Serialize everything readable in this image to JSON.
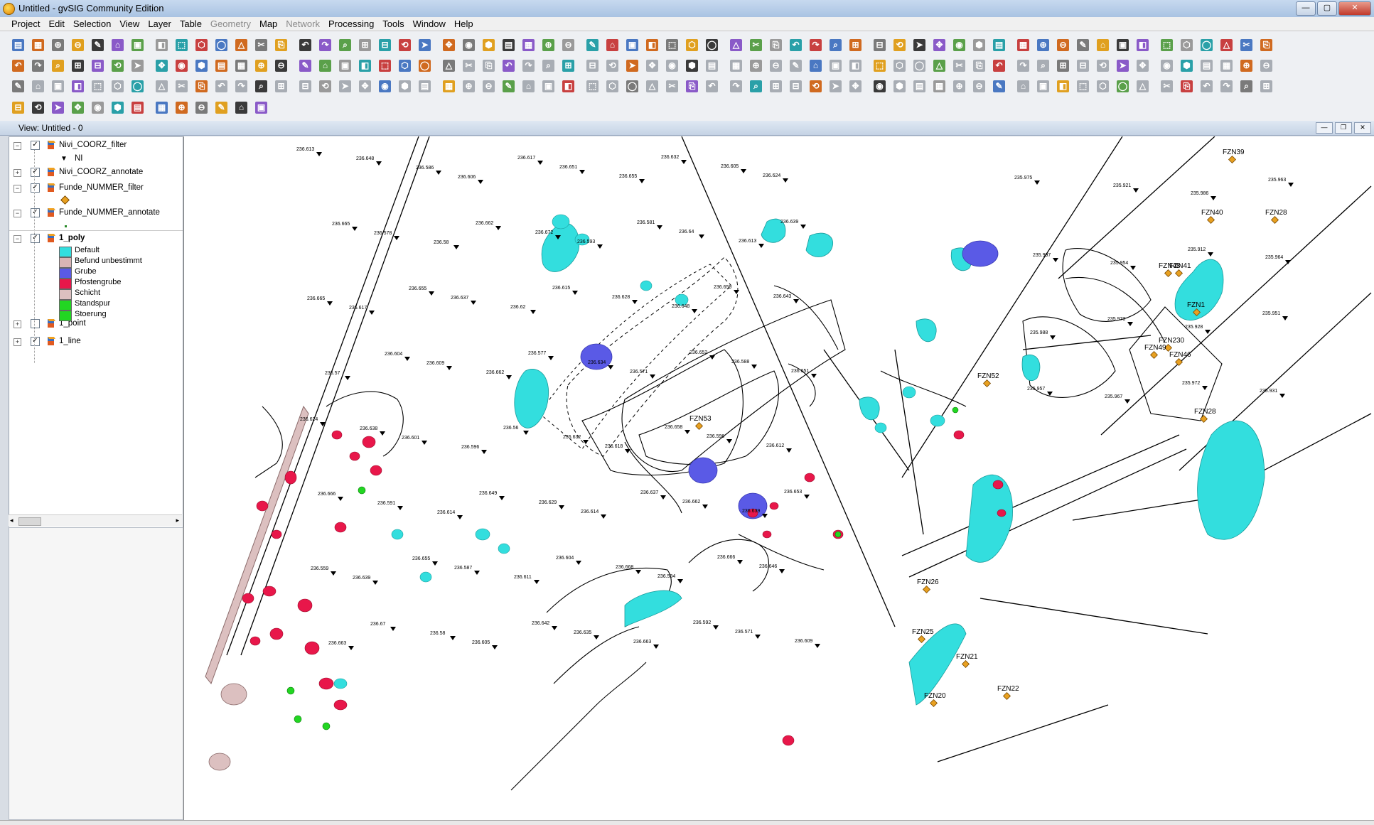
{
  "window": {
    "title": "Untitled - gvSIG Community Edition",
    "minimize": "—",
    "maximize": "▢",
    "close": "✕"
  },
  "menu": [
    {
      "key": "project",
      "label": "Project",
      "disabled": false
    },
    {
      "key": "edit",
      "label": "Edit",
      "disabled": false
    },
    {
      "key": "selection",
      "label": "Selection",
      "disabled": false
    },
    {
      "key": "view",
      "label": "View",
      "disabled": false
    },
    {
      "key": "layer",
      "label": "Layer",
      "disabled": false
    },
    {
      "key": "table",
      "label": "Table",
      "disabled": false
    },
    {
      "key": "geometry",
      "label": "Geometry",
      "disabled": true
    },
    {
      "key": "map",
      "label": "Map",
      "disabled": false
    },
    {
      "key": "network",
      "label": "Network",
      "disabled": true
    },
    {
      "key": "processing",
      "label": "Processing",
      "disabled": false
    },
    {
      "key": "tools",
      "label": "Tools",
      "disabled": false
    },
    {
      "key": "window",
      "label": "Window",
      "disabled": false
    },
    {
      "key": "help",
      "label": "Help",
      "disabled": false
    }
  ],
  "view": {
    "title": "View: Untitled - 0"
  },
  "toc": {
    "layers": [
      {
        "name": "Nivi_COORZ_filter",
        "checked": true,
        "expanded": true
      },
      {
        "name": "NI",
        "legend": true
      },
      {
        "name": "Nivi_COORZ_annotate",
        "checked": true,
        "expanded": false
      },
      {
        "name": "Funde_NUMMER_filter",
        "checked": true,
        "expanded": true
      },
      {
        "name": "Funde_NUMMER_annotate",
        "checked": true,
        "expanded": true
      },
      {
        "name": "1_poly",
        "checked": true,
        "expanded": true,
        "bold": true
      },
      {
        "name": "1_point",
        "checked": false,
        "expanded": false
      },
      {
        "name": "1_line",
        "checked": true,
        "expanded": false
      }
    ],
    "poly_legend": [
      {
        "label": "Default",
        "color": "#33dede"
      },
      {
        "label": "Befund unbestimmt",
        "color": "#d9b5b5"
      },
      {
        "label": "Grube",
        "color": "#5a5ae6"
      },
      {
        "label": "Pfostengrube",
        "color": "#e8174a"
      },
      {
        "label": "Schicht",
        "color": "#dcc0c0"
      },
      {
        "label": "Standspur",
        "color": "#22d622"
      },
      {
        "label": "Stoerung",
        "color": "#22d622"
      }
    ]
  },
  "map": {
    "colors": {
      "default": "#33dede",
      "grube": "#5a5ae6",
      "pfosten": "#e8174a",
      "standspur": "#22d622",
      "schicht": "#dcc0c0",
      "find": "#e8a020"
    },
    "finds": [
      {
        "label": "FZN39"
      },
      {
        "label": "FZN40"
      },
      {
        "label": "FZN28"
      },
      {
        "label": "FZN48"
      },
      {
        "label": "FZN41"
      },
      {
        "label": "FZN1"
      },
      {
        "label": "FZN230"
      },
      {
        "label": "FZN49"
      },
      {
        "label": "FZN46"
      },
      {
        "label": "FZN52"
      },
      {
        "label": "FZN28"
      },
      {
        "label": "FZN53"
      },
      {
        "label": "FZN26"
      },
      {
        "label": "FZN25"
      },
      {
        "label": "FZN21"
      },
      {
        "label": "FZN22"
      },
      {
        "label": "FZN20"
      }
    ],
    "heights": [
      "236.613",
      "236.648",
      "236.586",
      "236.606",
      "236.617",
      "236.651",
      "236.655",
      "236.632",
      "236.605",
      "236.624",
      "236.665",
      "236.578",
      "236.58",
      "236.662",
      "236.672",
      "236.593",
      "236.581",
      "236.64",
      "236.613",
      "236.639",
      "236.665",
      "236.617",
      "236.655",
      "236.637",
      "236.62",
      "236.615",
      "236.628",
      "236.648",
      "236.659",
      "236.643",
      "236.57",
      "236.604",
      "236.609",
      "236.662",
      "236.577",
      "236.634",
      "236.571",
      "236.652",
      "236.588",
      "236.651",
      "236.624",
      "236.638",
      "236.601",
      "236.596",
      "236.56",
      "236.632",
      "236.618",
      "236.658",
      "236.596",
      "236.612",
      "236.666",
      "236.591",
      "236.614",
      "236.649",
      "236.629",
      "236.614",
      "236.637",
      "236.662",
      "236.639",
      "236.653",
      "236.559",
      "236.639",
      "236.655",
      "236.587",
      "236.611",
      "236.604",
      "236.668",
      "236.594",
      "236.666",
      "236.646",
      "236.663",
      "236.67",
      "236.58",
      "236.605",
      "236.642",
      "236.635",
      "236.663",
      "236.592",
      "236.571",
      "236.609",
      "235.975",
      "235.921",
      "235.986",
      "235.963",
      "235.997",
      "235.954",
      "235.912",
      "235.964",
      "235.988",
      "235.973",
      "235.928",
      "235.951",
      "235.957",
      "235.967",
      "235.972",
      "235.931"
    ]
  }
}
